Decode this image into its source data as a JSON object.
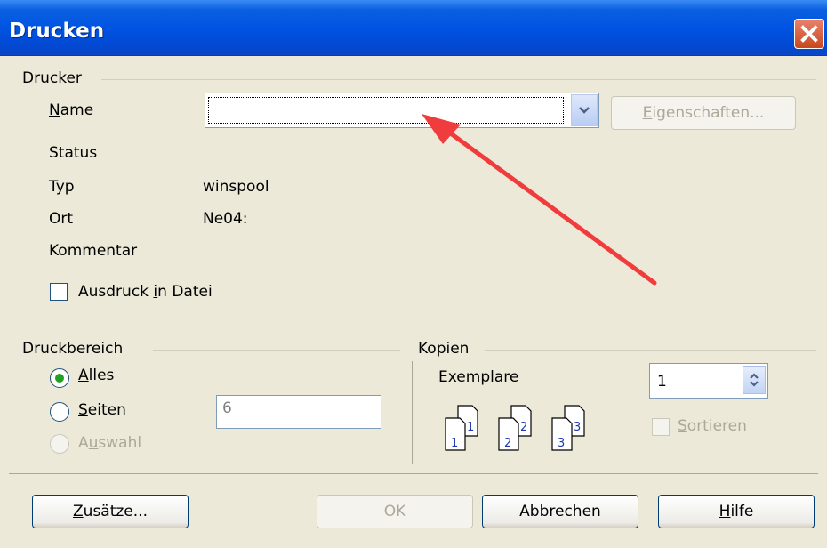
{
  "window": {
    "title": "Drucken"
  },
  "printer": {
    "group_label": "Drucker",
    "name_label": "Name",
    "name_value": "",
    "properties_button": "Eigenschaften...",
    "status_label": "Status",
    "status_value": "",
    "type_label": "Typ",
    "type_value": "winspool",
    "location_label": "Ort",
    "location_value": "Ne04:",
    "comment_label": "Kommentar",
    "comment_value": "",
    "print_to_file_label": "Ausdruck in Datei"
  },
  "print_range": {
    "group_label": "Druckbereich",
    "all_label": "Alles",
    "pages_label": "Seiten",
    "pages_value": "6",
    "selection_label": "Auswahl",
    "selected": "all"
  },
  "copies": {
    "group_label": "Kopien",
    "count_label": "Exemplare",
    "count_value": "1",
    "collate_label": "Sortieren",
    "page_icon_numbers": [
      "1",
      "1",
      "2",
      "2",
      "3",
      "3"
    ]
  },
  "buttons": {
    "options": "Zusätze...",
    "ok": "OK",
    "cancel": "Abbrechen",
    "help": "Hilfe"
  },
  "colors": {
    "title_bar": "#0054e3",
    "dialog_bg": "#ece9d8",
    "annotation_arrow": "#f03c3c",
    "close_button": "#d2542c"
  }
}
